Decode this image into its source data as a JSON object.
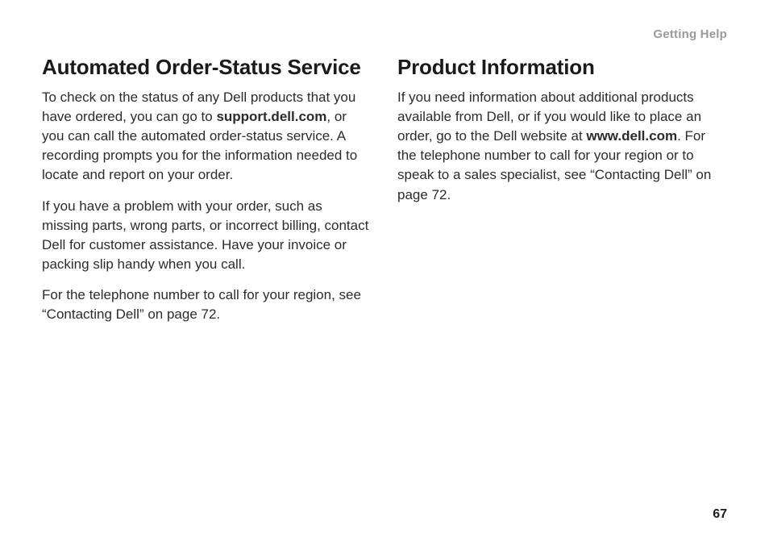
{
  "running_head": "Getting Help",
  "page_number": "67",
  "left": {
    "heading": "Automated Order-Status Service",
    "p1_a": "To check on the status of any Dell products that you have ordered, you can go to ",
    "p1_bold": "support.dell.com",
    "p1_b": ", or you can call the automated order-status service. A recording prompts you for the information needed to locate and report on your order.",
    "p2": "If you have a problem with your order, such as missing parts, wrong parts, or incorrect billing, contact Dell for customer assistance. Have your invoice or packing slip handy when you call.",
    "p3": "For the telephone number to call for your region, see “Contacting Dell” on page 72."
  },
  "right": {
    "heading": "Product Information",
    "p1_a": "If you need information about additional products available from Dell, or if you would like to place an order, go to the Dell website at ",
    "p1_bold": "www.dell.com",
    "p1_b": ". For the telephone number to call for your region or to speak to a sales specialist, see “Contacting Dell” on page 72."
  }
}
